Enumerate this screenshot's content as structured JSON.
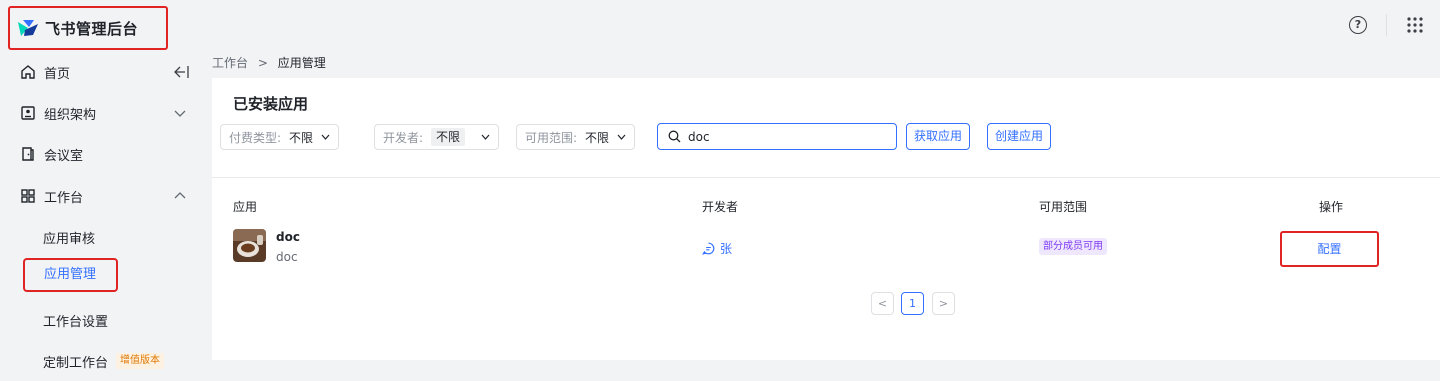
{
  "app": {
    "title": "飞书管理后台"
  },
  "topbar": {
    "help_label": "?",
    "help_icon": "question-circle-icon",
    "apps_icon": "grid-apps-icon"
  },
  "sidebar": {
    "items": [
      {
        "label": "首页",
        "icon": "home-icon"
      },
      {
        "label": "组织架构",
        "icon": "org-icon"
      },
      {
        "label": "会议室",
        "icon": "meeting-room-icon"
      },
      {
        "label": "工作台",
        "icon": "workspace-grid-icon"
      },
      {
        "label": "应用审核"
      },
      {
        "label": "应用管理"
      },
      {
        "label": "工作台设置"
      },
      {
        "label": "定制工作台",
        "badge": "增值版本"
      }
    ]
  },
  "breadcrumb": {
    "parent": "工作台",
    "separator": ">",
    "current": "应用管理"
  },
  "panel": {
    "title": "已安装应用",
    "filters": [
      {
        "label": "付费类型:",
        "value": "不限"
      },
      {
        "label": "开发者:",
        "value": "不限"
      },
      {
        "label": "可用范围:",
        "value": "不限"
      }
    ],
    "search": {
      "value": "doc",
      "placeholder": ""
    },
    "buttons": {
      "get_app": "获取应用",
      "create_app": "创建应用"
    }
  },
  "table": {
    "columns": [
      "应用",
      "开发者",
      "可用范围",
      "操作"
    ],
    "rows": [
      {
        "name": "doc",
        "subtitle": "doc",
        "developer": "张",
        "scope": "部分成员可用",
        "action": "配置"
      }
    ]
  },
  "pagination": {
    "prev": "<",
    "current": "1",
    "next": ">"
  },
  "colors": {
    "accent": "#3370ff",
    "highlight": "#e02424",
    "scope_tag": "#7f3bf5",
    "badge": "#de7802"
  }
}
